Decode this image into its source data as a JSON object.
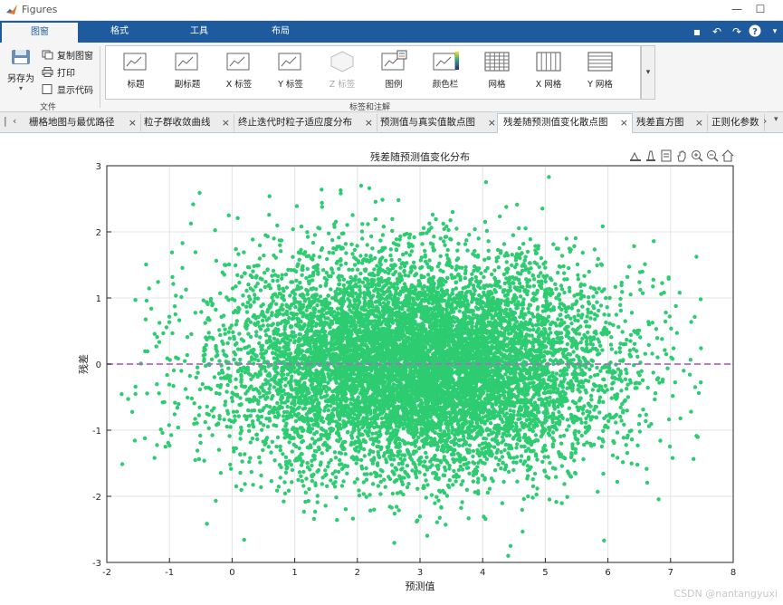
{
  "window": {
    "title": "Figures"
  },
  "ribbon_tabs": [
    {
      "label": "图窗",
      "active": true
    },
    {
      "label": "格式"
    },
    {
      "label": "工具"
    },
    {
      "label": "布局"
    }
  ],
  "file_group": {
    "save_as": "另存为",
    "copy_figure": "复制图窗",
    "print": "打印",
    "show_code": "显示代码",
    "group_label": "文件"
  },
  "labels_group": {
    "buttons": [
      {
        "label": "标题"
      },
      {
        "label": "副标题"
      },
      {
        "label": "X 标签"
      },
      {
        "label": "Y 标签"
      },
      {
        "label": "Z 标签",
        "disabled": true
      },
      {
        "label": "图例"
      },
      {
        "label": "颜色栏"
      },
      {
        "label": "网格"
      },
      {
        "label": "X 网格"
      },
      {
        "label": "Y 网格"
      }
    ],
    "group_label": "标签和注解"
  },
  "doc_tabs": [
    {
      "label": "栅格地图与最优路径"
    },
    {
      "label": "粒子群收敛曲线"
    },
    {
      "label": "终止迭代时粒子适应度分布"
    },
    {
      "label": "预测值与真实值散点图"
    },
    {
      "label": "残差随预测值变化散点图",
      "active": true
    },
    {
      "label": "残差直方图"
    },
    {
      "label": "正则化参数"
    }
  ],
  "chart_data": {
    "type": "scatter",
    "title": "残差随预测值变化分布",
    "xlabel": "预测值",
    "ylabel": "残差",
    "xlim": [
      -2,
      8
    ],
    "ylim": [
      -3,
      3
    ],
    "xticks": [
      -2,
      -1,
      0,
      1,
      2,
      3,
      4,
      5,
      6,
      7,
      8
    ],
    "yticks": [
      -3,
      -2,
      -1,
      0,
      1,
      2,
      3
    ],
    "grid": true,
    "marker_color": "#2ecc71",
    "reference_line": {
      "y": 0,
      "style": "dashed",
      "color": "#b565c8"
    },
    "distribution": {
      "n_points": 10000,
      "x_center": 3.0,
      "x_std": 1.5,
      "y_center": 0,
      "y_std": 0.8,
      "x_range_observed": [
        -1.8,
        7.5
      ],
      "y_range_observed": [
        -2.95,
        3.0
      ]
    }
  },
  "watermark": "CSDN @nantangyuxi"
}
